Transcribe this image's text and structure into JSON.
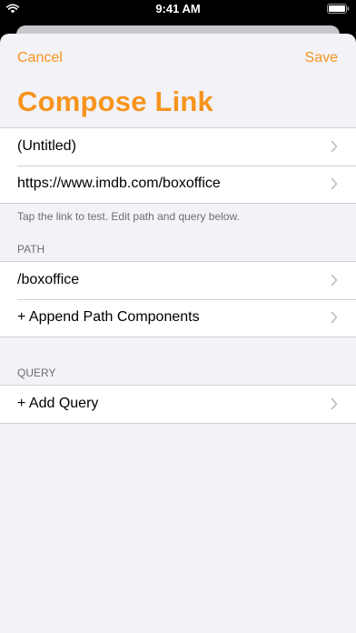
{
  "status_bar": {
    "time": "9:41 AM"
  },
  "nav": {
    "cancel_label": "Cancel",
    "save_label": "Save",
    "title": "Compose Link"
  },
  "link_group": {
    "rows": [
      {
        "label": "(Untitled)"
      },
      {
        "label": "https://www.imdb.com/boxoffice"
      }
    ],
    "footer": "Tap the link to test. Edit path and query below."
  },
  "path_section": {
    "header": "PATH",
    "rows": [
      {
        "label": "/boxoffice"
      },
      {
        "label": "+ Append Path Components"
      }
    ]
  },
  "query_section": {
    "header": "QUERY",
    "rows": [
      {
        "label": "+ Add Query"
      }
    ]
  },
  "colors": {
    "accent": "#f7941d",
    "background": "#f2f2f7",
    "cell": "#ffffff",
    "secondary_text": "#6d6d72",
    "chevron": "#c4c4c7"
  },
  "icons": [
    "wifi-icon",
    "battery-icon",
    "chevron-right-icon"
  ]
}
